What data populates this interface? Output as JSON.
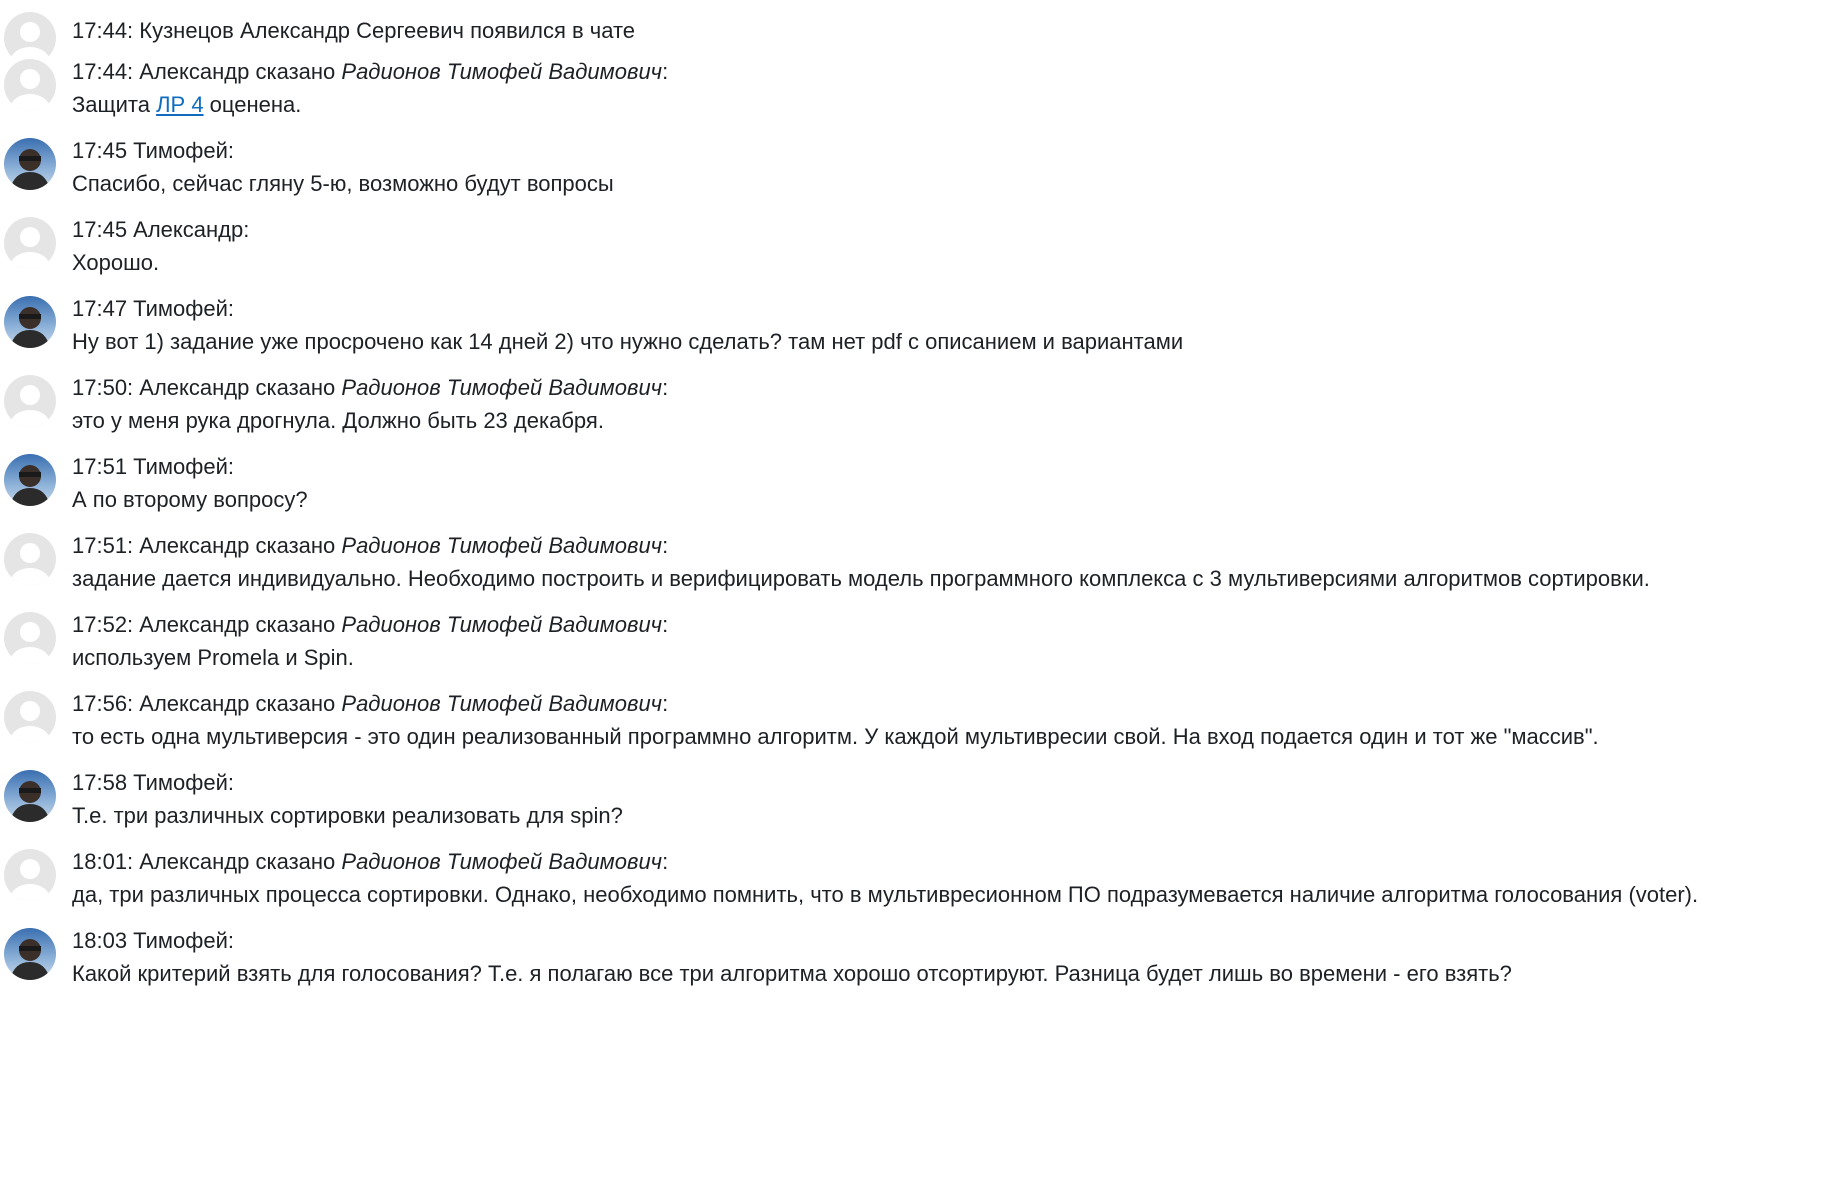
{
  "messages": [
    {
      "avatar": "default",
      "kind": "system",
      "text": "17:44: Кузнецов Александр Сергеевич появился в чате"
    },
    {
      "avatar": "default",
      "kind": "said",
      "prefix": "17:44: Александр сказано ",
      "about": "Радионов Тимофей Вадимович",
      "suffix": ":",
      "text_before": "Защита ",
      "link": "ЛР 4",
      "text_after": " оценена."
    },
    {
      "avatar": "photo",
      "kind": "plain",
      "header": "17:45 Тимофей:",
      "text": "Спасибо, сейчас гляну 5-ю, возможно будут вопросы"
    },
    {
      "avatar": "default",
      "kind": "plain",
      "header": "17:45 Александр:",
      "text": "Хорошо."
    },
    {
      "avatar": "photo",
      "kind": "plain",
      "header": "17:47 Тимофей:",
      "text": "Ну вот 1) задание уже просрочено как 14 дней 2) что нужно сделать? там нет pdf с описанием и вариантами"
    },
    {
      "avatar": "default",
      "kind": "said",
      "prefix": "17:50: Александр сказано ",
      "about": "Радионов Тимофей Вадимович",
      "suffix": ":",
      "text": "это у меня рука дрогнула. Должно быть 23 декабря."
    },
    {
      "avatar": "photo",
      "kind": "plain",
      "header": "17:51 Тимофей:",
      "text": "А по второму вопросу?"
    },
    {
      "avatar": "default",
      "kind": "said",
      "prefix": "17:51: Александр сказано ",
      "about": "Радионов Тимофей Вадимович",
      "suffix": ":",
      "text": "задание дается индивидуально. Необходимо построить и верифицировать модель программного комплекса с 3 мультиверсиями алгоритмов сортировки."
    },
    {
      "avatar": "default",
      "kind": "said",
      "prefix": "17:52: Александр сказано ",
      "about": "Радионов Тимофей Вадимович",
      "suffix": ":",
      "text": "используем Promela и Spin."
    },
    {
      "avatar": "default",
      "kind": "said",
      "prefix": "17:56: Александр сказано ",
      "about": "Радионов Тимофей Вадимович",
      "suffix": ":",
      "text": "то есть одна мультиверсия - это один реализованный программно алгоритм. У каждой мультивресии свой. На вход подается один и тот же \"массив\"."
    },
    {
      "avatar": "photo",
      "kind": "plain",
      "header": "17:58 Тимофей:",
      "text": "Т.е. три различных сортировки реализовать для spin?"
    },
    {
      "avatar": "default",
      "kind": "said",
      "prefix": "18:01: Александр сказано ",
      "about": "Радионов Тимофей Вадимович",
      "suffix": ":",
      "text": "да, три различных процесса сортировки. Однако, необходимо помнить, что в мультивресионном ПО подразумевается наличие алгоритма голосования (voter)."
    },
    {
      "avatar": "photo",
      "kind": "plain",
      "header": "18:03 Тимофей:",
      "text": "Какой критерий взять для голосования? Т.е. я полагаю все три алгоритма хорошо отсортируют. Разница будет лишь во времени - его взять?"
    }
  ],
  "colors": {
    "text": "#1d2125",
    "link": "#0f6cbf",
    "default_avatar": "#e5e5e5"
  }
}
